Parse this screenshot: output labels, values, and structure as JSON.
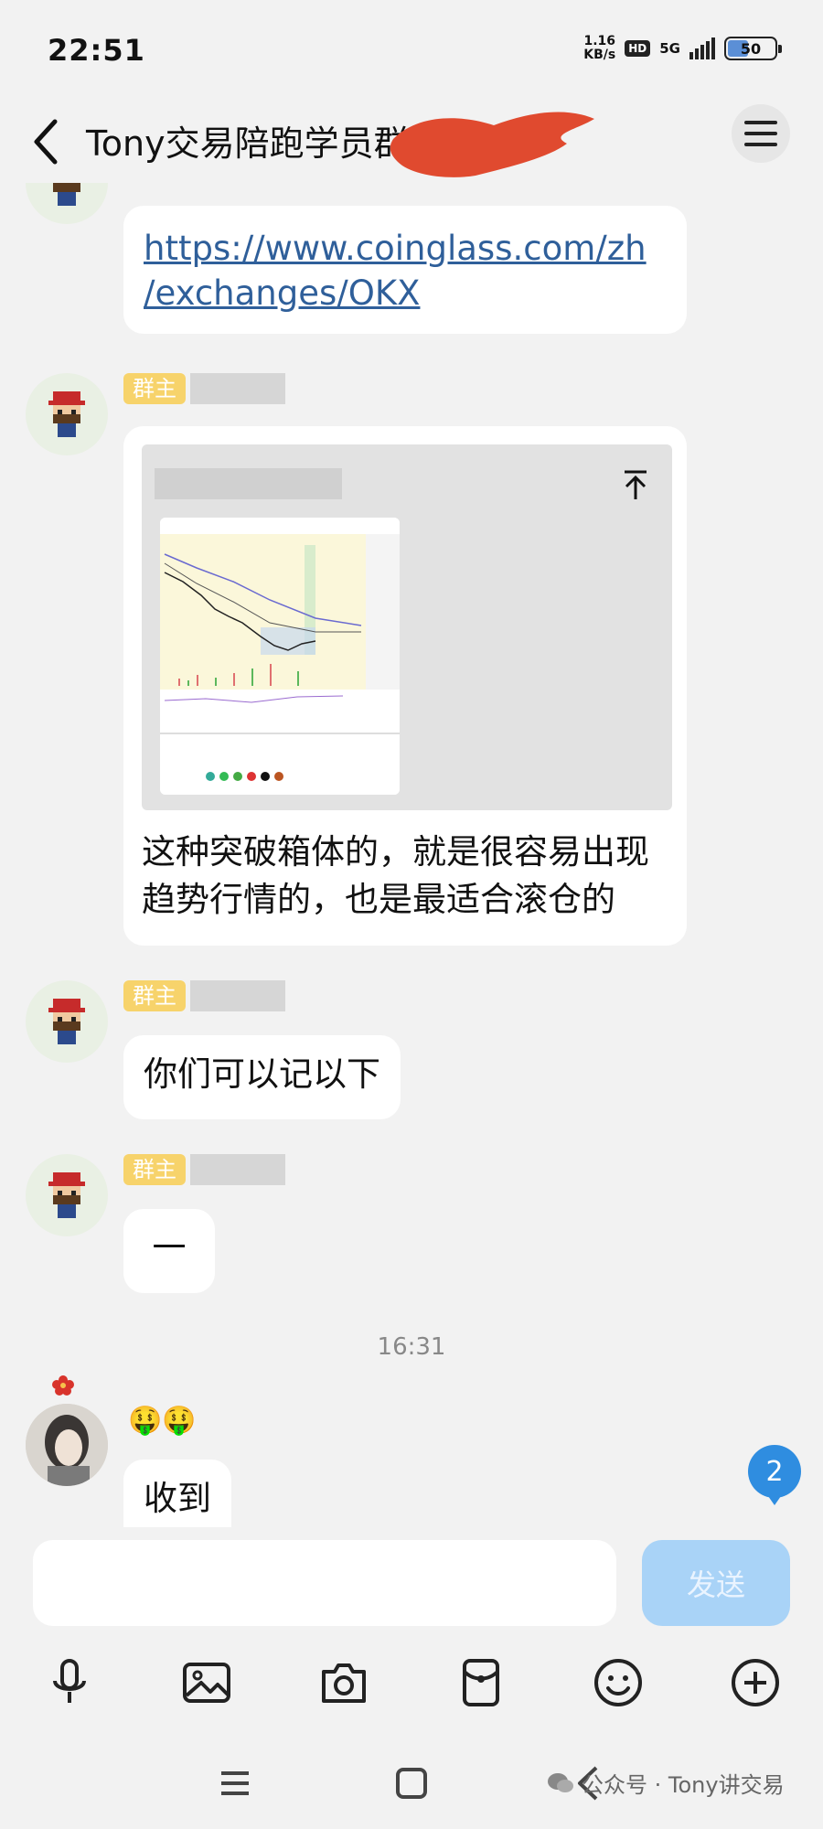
{
  "status": {
    "time": "22:51",
    "speed_value": "1.16",
    "speed_unit": "KB/s",
    "hd": "HD",
    "network": "5G",
    "battery": "50"
  },
  "header": {
    "title": "Tony交易陪跑学员群(",
    "menu_icon": "menu-icon"
  },
  "messages": {
    "link_line1": "https://www.coinglass.com/zh",
    "link_line2": "/exchanges/OKX",
    "owner_badge": "群主",
    "card_text_line1": "这种突破箱体的，就是很容易出现",
    "card_text_line2": "趋势行情的，也是最适合滚仓的",
    "msg_2": "你们可以记以下",
    "msg_3": "一",
    "timestamp": "16:31",
    "emoji_line": "🤑🤑",
    "msg_4": "收到"
  },
  "unread_count": "2",
  "input": {
    "placeholder": "",
    "send_label": "发送"
  },
  "watermark": "公众号 · Tony讲交易",
  "colors": {
    "link": "#2f5f9a",
    "owner_badge": "#f7d36b",
    "send_disabled": "#a9d3f7",
    "unread_badge": "#2f8de0",
    "redaction": "#e04a2f"
  }
}
